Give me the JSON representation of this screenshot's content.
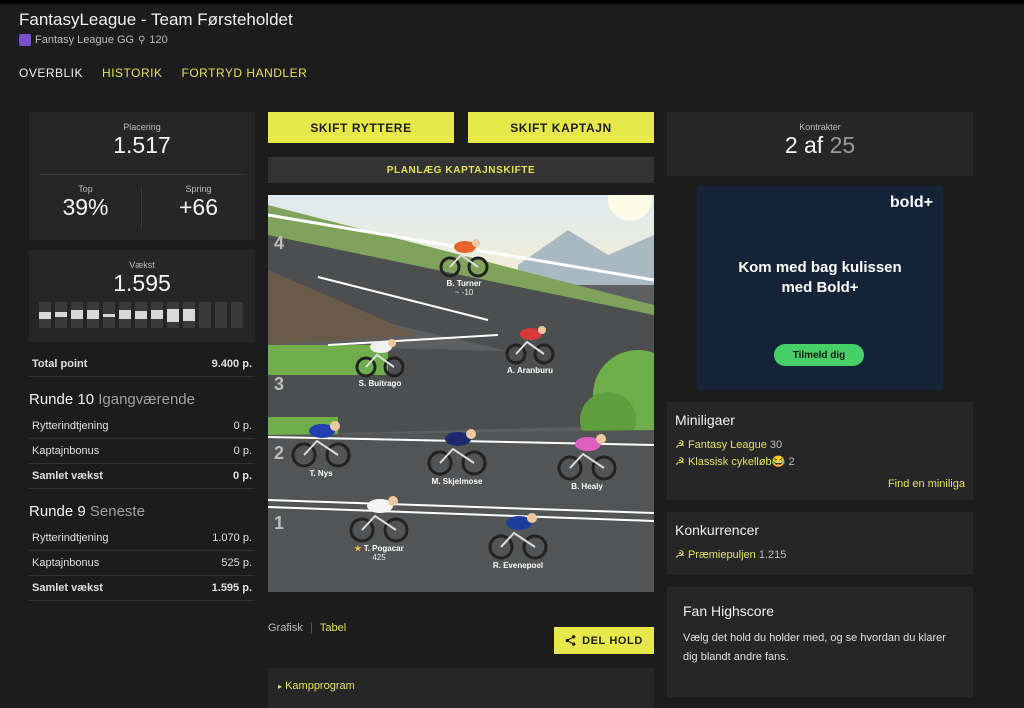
{
  "header": {
    "title": "FantasyLeague - Team Førsteholdet",
    "league": "Fantasy League GG",
    "league_icon": "league-logo",
    "trophy_icon": "trophy-icon",
    "trophies": "120"
  },
  "nav": [
    {
      "label": "OVERBLIK"
    },
    {
      "label": "HISTORIK"
    },
    {
      "label": "FORTRYD HANDLER"
    }
  ],
  "stats": {
    "placering_label": "Placering",
    "placering": "1.517",
    "top_label": "Top",
    "top": "39%",
    "spring_label": "Spring",
    "spring": "+66",
    "vaekst_label": "Vækst",
    "vaekst": "1.595",
    "vaekst_bars": [
      0.25,
      0.2,
      0.35,
      0.35,
      0.1,
      0.35,
      0.3,
      0.35,
      0.5,
      0.45,
      0,
      0,
      0
    ]
  },
  "total": {
    "label": "Total point",
    "value": "9.400 p."
  },
  "round10": {
    "title": "Runde 10",
    "status": "Igangværende",
    "rows": [
      {
        "label": "Rytterindtjening",
        "value": "0 p."
      },
      {
        "label": "Kaptajnbonus",
        "value": "0 p."
      },
      {
        "label": "Samlet vækst",
        "value": "0 p."
      }
    ]
  },
  "round9": {
    "title": "Runde 9",
    "status": "Seneste",
    "rows": [
      {
        "label": "Rytterindtjening",
        "value": "1.070 p."
      },
      {
        "label": "Kaptajnbonus",
        "value": "525 p."
      },
      {
        "label": "Samlet vækst",
        "value": "1.595 p."
      }
    ]
  },
  "buttons": {
    "skift_ryttere": "SKIFT RYTTERE",
    "skift_kaptajn": "SKIFT KAPTAJN",
    "plan": "PLANLÆG KAPTAJNSKIFTE",
    "share": "DEL HOLD"
  },
  "rows_numbers": [
    "4",
    "3",
    "2",
    "1"
  ],
  "riders": [
    {
      "name": "B. Turner",
      "pts": "~ -10",
      "jersey": "#e8642c"
    },
    {
      "name": "A. Aranburu",
      "pts": "",
      "jersey": "#d83838"
    },
    {
      "name": "S. Buitrago",
      "pts": "",
      "jersey": "#f0f0f0"
    },
    {
      "name": "T. Nys",
      "pts": "",
      "jersey": "#2040b0"
    },
    {
      "name": "M. Skjelmose",
      "pts": "",
      "jersey": "#1f2a6e"
    },
    {
      "name": "B. Healy",
      "pts": "",
      "jersey": "#e060c0"
    },
    {
      "name": "T. Pogacar",
      "pts": "425",
      "jersey": "#f4f4f4"
    },
    {
      "name": "R. Evenepoel",
      "pts": "",
      "jersey": "#1c3d9a"
    }
  ],
  "view_tabs": {
    "grafisk": "Grafisk",
    "tabel": "Tabel"
  },
  "kampprogram": "Kampprogram",
  "contracts": {
    "label": "Kontrakter",
    "used": "2 af",
    "total": "25"
  },
  "ad": {
    "brand": "bold+",
    "headline_1": "Kom med bag kulissen",
    "headline_2": "med Bold+",
    "cta": "Tilmeld dig"
  },
  "miniligaer": {
    "title": "Miniligaer",
    "items": [
      {
        "name": "Fantasy League",
        "count": "30"
      },
      {
        "name": "Klassisk cykelløb😂",
        "count": "2"
      }
    ],
    "find": "Find en miniliga"
  },
  "konkurrencer": {
    "title": "Konkurrencer",
    "items": [
      {
        "name": "Præmiepuljen",
        "count": "1.215"
      }
    ]
  },
  "fan": {
    "title": "Fan Highscore",
    "text": "Vælg det hold du holder med, og se hvordan du klarer dig blandt andre fans."
  }
}
